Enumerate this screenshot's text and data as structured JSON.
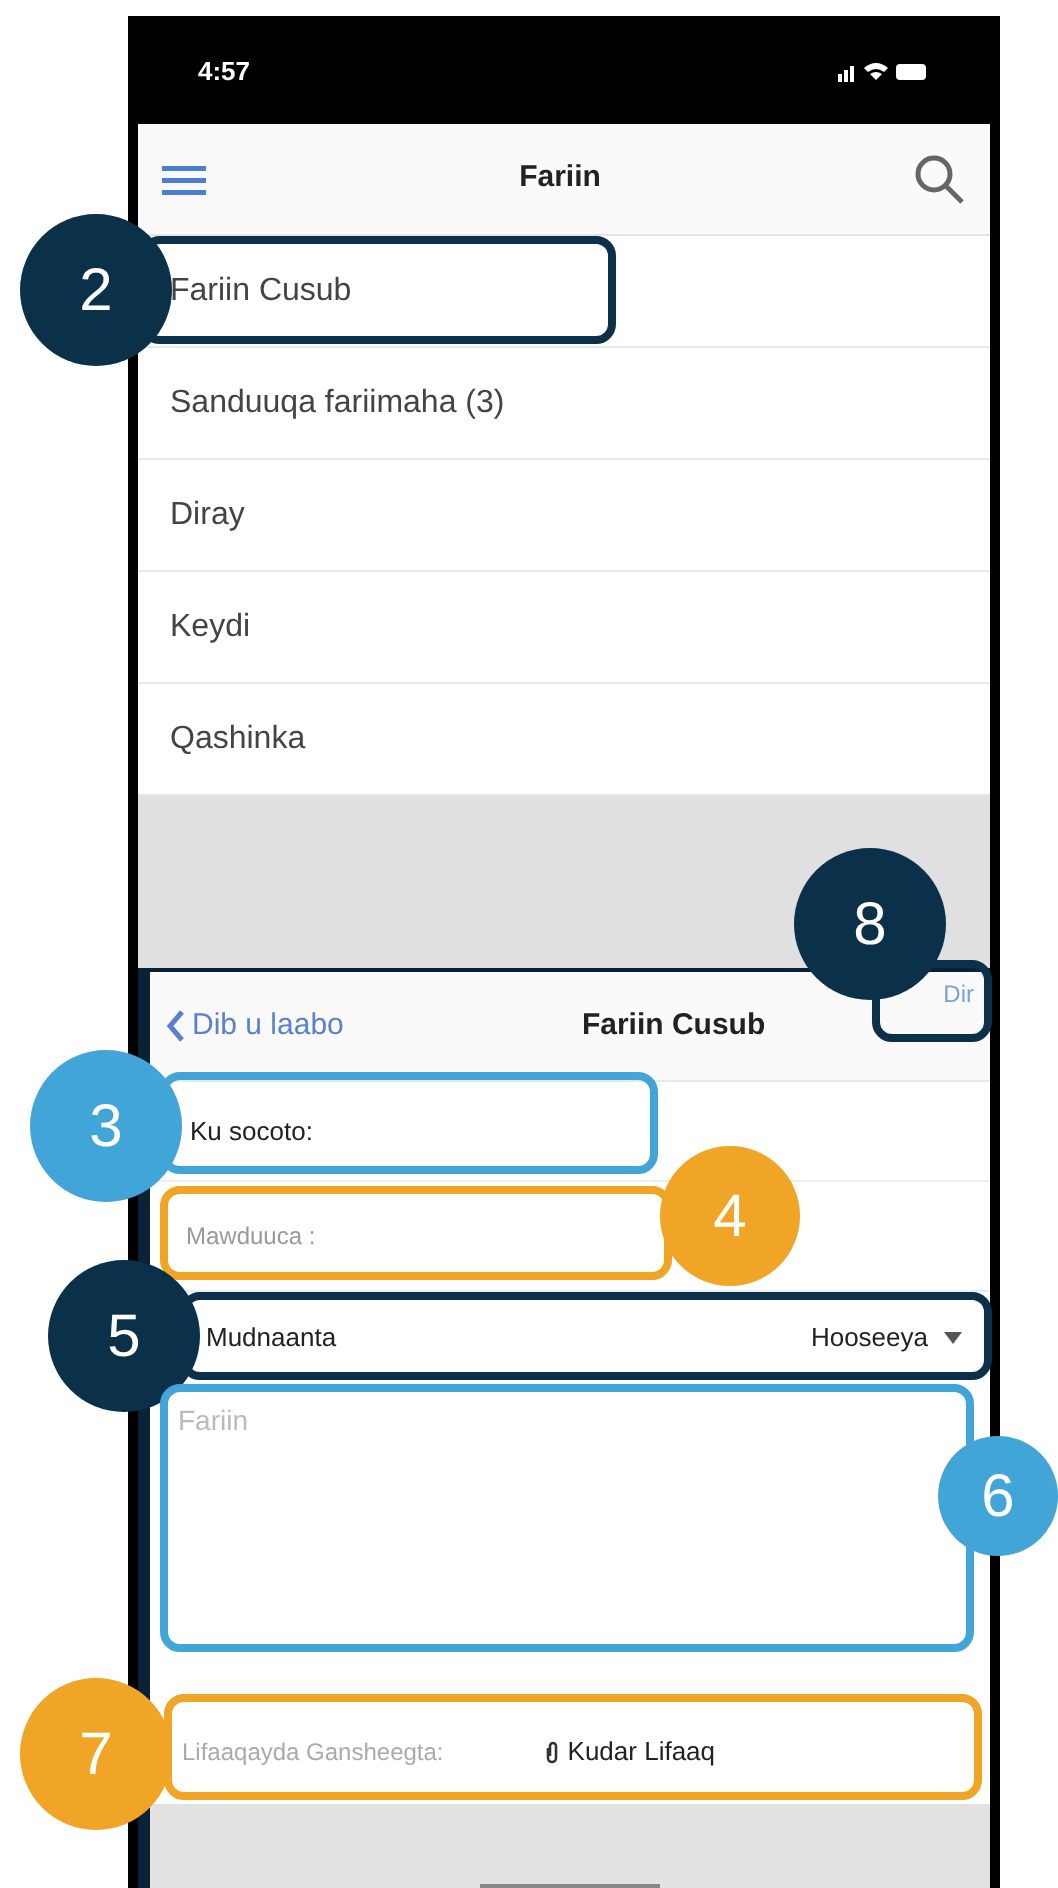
{
  "status_bar": {
    "time": "4:57"
  },
  "top_nav": {
    "title": "Fariin"
  },
  "menu_items": [
    {
      "label": "Fariin Cusub"
    },
    {
      "label": "Sanduuqa fariimaha (3)"
    },
    {
      "label": "Diray"
    },
    {
      "label": "Keydi"
    },
    {
      "label": "Qashinka"
    }
  ],
  "compose": {
    "back": "Dib u laabo",
    "title": "Fariin Cusub",
    "send": "Dir",
    "to_label": "Ku socoto:",
    "subject_placeholder": "Mawduuca :",
    "priority_label": "Mudnaanta",
    "priority_value": "Hooseeya",
    "message_placeholder": "Fariin",
    "attachments_label": "Lifaaqayda Gansheegta:",
    "add_attachment": "Kudar Lifaaq"
  },
  "callouts": [
    {
      "number": "2",
      "color": "#0b3049"
    },
    {
      "number": "8",
      "color": "#0b3049"
    },
    {
      "number": "3",
      "color": "#42a5d8"
    },
    {
      "number": "4",
      "color": "#f0a526"
    },
    {
      "number": "5",
      "color": "#0b3049"
    },
    {
      "number": "6",
      "color": "#42a5d8"
    },
    {
      "number": "7",
      "color": "#f0a526"
    }
  ]
}
